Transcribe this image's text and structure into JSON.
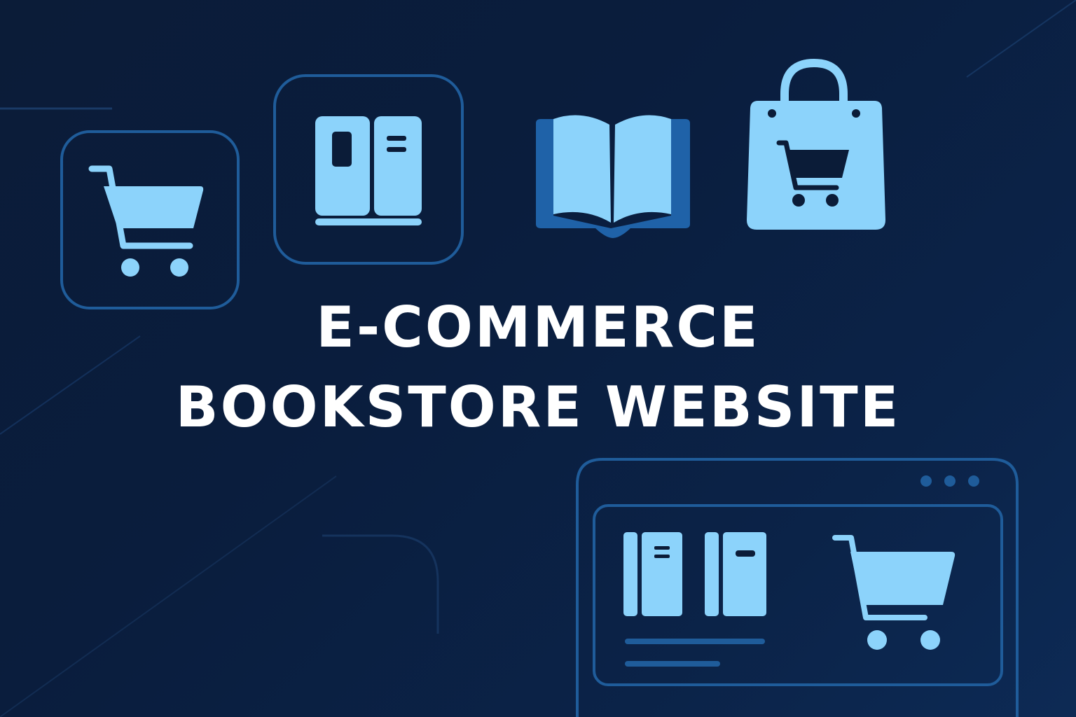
{
  "title": {
    "line1": "E-COMMERCE",
    "line2": "BOOKSTORE WEBSITE"
  },
  "icons": [
    "shopping-cart-icon",
    "books-icon",
    "open-book-icon",
    "shopping-bag-icon",
    "browser-window-icon"
  ],
  "colors": {
    "background": "#0b1c38",
    "icon_fill": "#8cd3fb",
    "outline": "#1f5c9a",
    "text": "#ffffff"
  }
}
